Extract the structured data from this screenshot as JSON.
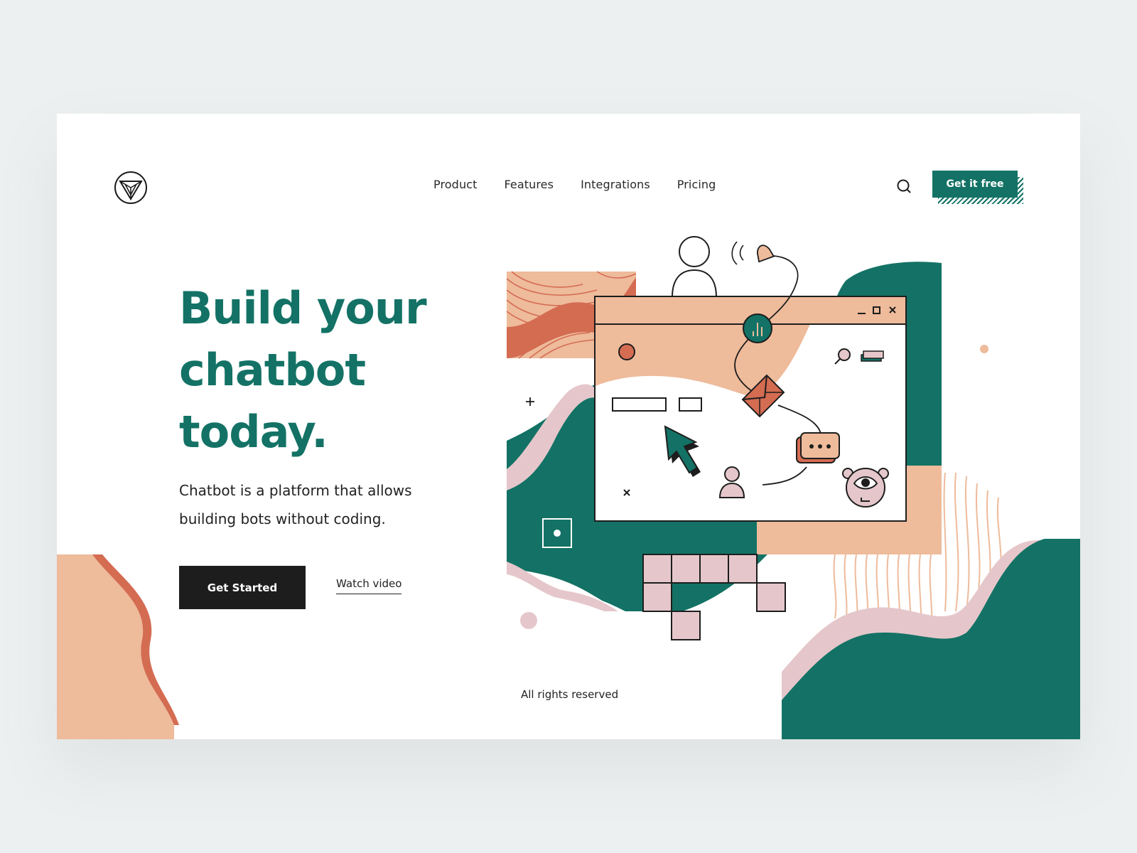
{
  "brand": {
    "logo": "logo-triangle-icon"
  },
  "nav": {
    "items": [
      {
        "label": "Product"
      },
      {
        "label": "Features"
      },
      {
        "label": "Integrations"
      },
      {
        "label": "Pricing"
      }
    ],
    "search_icon": "search-icon",
    "cta_label": "Get it free"
  },
  "hero": {
    "title_lines": [
      "Build your",
      "chatbot",
      "today."
    ],
    "subtitle_lines": [
      "Chatbot is a platform that allows",
      "building bots without coding."
    ],
    "primary_button": "Get Started",
    "secondary_link": "Watch video"
  },
  "footer": {
    "text": "All rights reserved"
  },
  "colors": {
    "accent": "#137265",
    "peach": "#eebb9b",
    "terracotta": "#d46c52",
    "pink": "#e5c7cb",
    "dark": "#1d1d1d"
  }
}
